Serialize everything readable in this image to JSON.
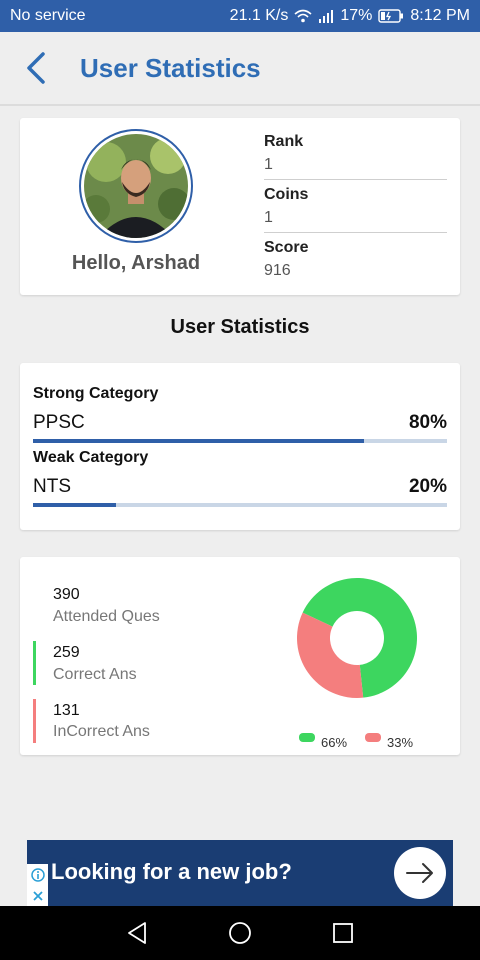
{
  "status_bar": {
    "carrier": "No service",
    "speed": "21.1 K/s",
    "battery": "17%",
    "time": "8:12 PM"
  },
  "app_bar": {
    "title": "User Statistics"
  },
  "profile": {
    "greeting": "Hello, Arshad",
    "rank_label": "Rank",
    "rank_value": "1",
    "coins_label": "Coins",
    "coins_value": "1",
    "score_label": "Score",
    "score_value": "916"
  },
  "section_title": "User Statistics",
  "categories": {
    "strong_label": "Strong Category",
    "strong_name": "PPSC",
    "strong_pct": "80%",
    "strong_value": 0.8,
    "weak_label": "Weak Category",
    "weak_name": "NTS",
    "weak_pct": "20%",
    "weak_value": 0.2
  },
  "answers": {
    "attended_value": "390",
    "attended_label": "Attended Ques",
    "correct_value": "259",
    "correct_label": "Correct Ans",
    "incorrect_value": "131",
    "incorrect_label": "InCorrect Ans"
  },
  "chart_data": {
    "type": "pie",
    "categories": [
      "Correct Ans",
      "InCorrect Ans"
    ],
    "values": [
      259,
      131
    ],
    "legend": [
      "66%",
      "33%"
    ],
    "colors": [
      "#3dd65f",
      "#f47e7e"
    ],
    "legend_position": "bottom"
  },
  "ad": {
    "text": "Looking for a new job?"
  },
  "colors": {
    "primary": "#2f5fa8",
    "title": "#2f6db5",
    "correct": "#3dd65f",
    "incorrect": "#f47e7e"
  }
}
